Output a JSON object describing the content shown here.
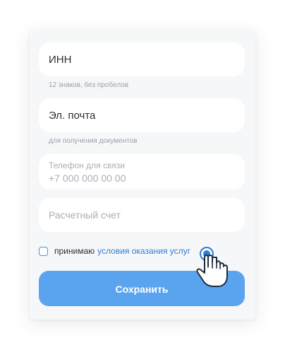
{
  "form": {
    "inn": {
      "value": "ИНН",
      "hint": "12 знаков, без пробелов"
    },
    "email": {
      "value": "Эл. почта",
      "hint": "для получения документов"
    },
    "phone": {
      "label": "Телефон для связи",
      "placeholder": "+7 000 000 00 00"
    },
    "account": {
      "placeholder": "Расчетный счет"
    },
    "consent": {
      "checked": false,
      "text": "принимаю",
      "link": "условия оказания услуг"
    },
    "save_label": "Сохранить"
  },
  "colors": {
    "accent": "#5aa4ef",
    "link": "#2f7ed6",
    "card_background": "#f6f7f9",
    "field_background": "#ffffff"
  },
  "icons": {
    "cursor": "hand-pointer-icon"
  }
}
